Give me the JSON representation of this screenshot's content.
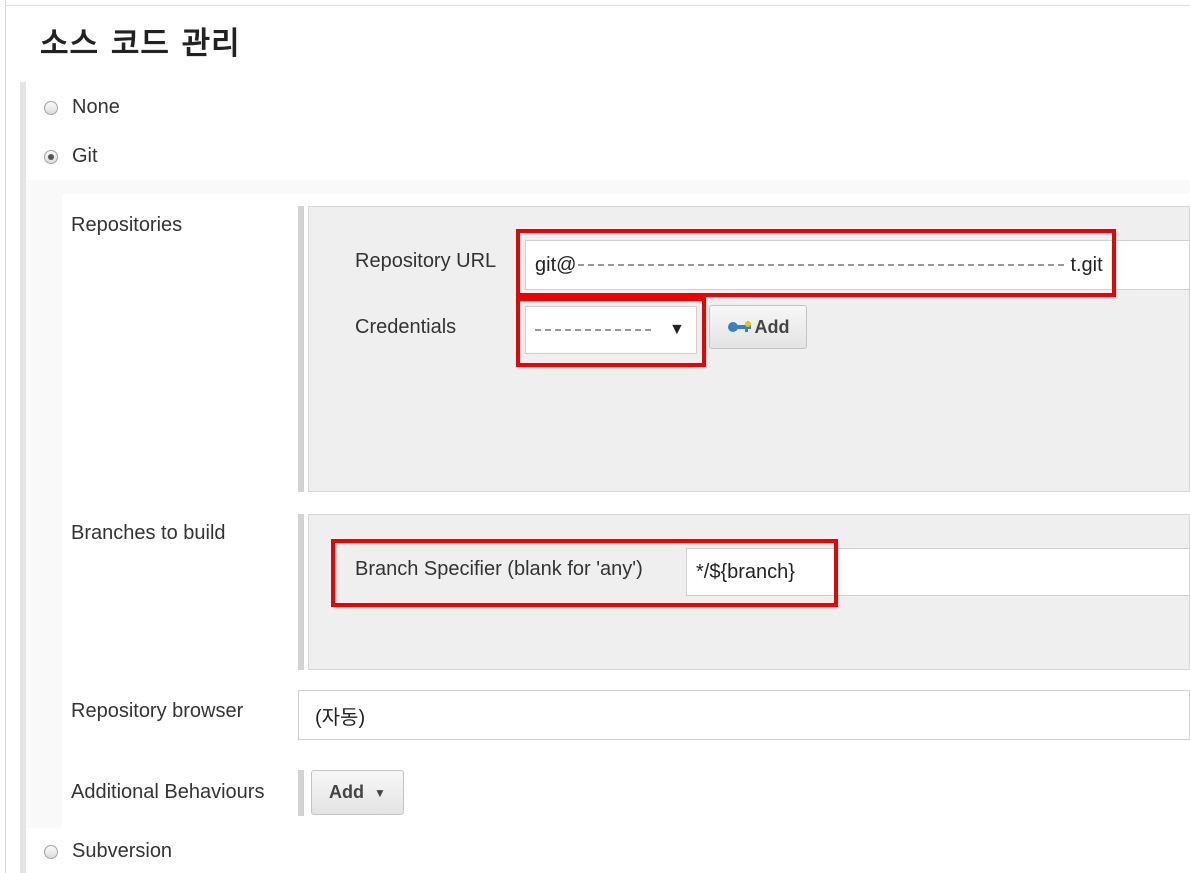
{
  "section": {
    "title": "소스 코드 관리"
  },
  "scm_options": {
    "none": "None",
    "git": "Git",
    "subversion": "Subversion"
  },
  "git": {
    "repositories_label": "Repositories",
    "repository_url_label": "Repository URL",
    "repository_url_prefix": "git@",
    "repository_url_suffix": "t.git",
    "credentials_label": "Credentials",
    "credentials_add_label": "Add",
    "branches_label": "Branches to build",
    "branch_specifier_label": "Branch Specifier (blank for 'any')",
    "branch_specifier_value": "*/${branch}",
    "repo_browser_label": "Repository browser",
    "repo_browser_value": "(자동)",
    "additional_behaviours_label": "Additional Behaviours",
    "additional_add_label": "Add"
  },
  "icons": {
    "key": "key-icon",
    "dropdown": "chevron-down-icon"
  },
  "colors": {
    "highlight": "#ee0000"
  }
}
